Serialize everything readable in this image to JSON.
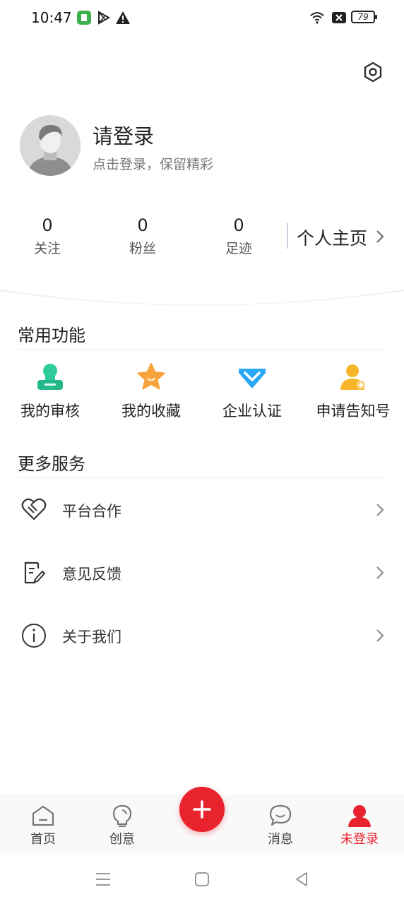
{
  "status_bar": {
    "time": "10:47",
    "battery": "79"
  },
  "header": {
    "login_title": "请登录",
    "login_subtitle": "点击登录，保留精彩",
    "stats": [
      {
        "value": "0",
        "label": "关注"
      },
      {
        "value": "0",
        "label": "粉丝"
      },
      {
        "value": "0",
        "label": "足迹"
      }
    ],
    "profile_link": "个人主页"
  },
  "common_functions": {
    "title": "常用功能",
    "items": [
      {
        "label": "我的审核",
        "icon": "stamp-icon",
        "color": "#2ecb9b"
      },
      {
        "label": "我的收藏",
        "icon": "star-icon",
        "color": "#f7a23b"
      },
      {
        "label": "企业认证",
        "icon": "diamond-v-icon",
        "color": "#29a7f5"
      },
      {
        "label": "申请告知号",
        "icon": "user-add-icon",
        "color": "#f7b52a"
      }
    ]
  },
  "more_services": {
    "title": "更多服务",
    "items": [
      {
        "label": "平台合作",
        "icon": "handshake-icon"
      },
      {
        "label": "意见反馈",
        "icon": "feedback-icon"
      },
      {
        "label": "关于我们",
        "icon": "info-icon"
      }
    ]
  },
  "bottom_nav": {
    "items": [
      {
        "label": "首页",
        "icon": "home-icon",
        "active": false
      },
      {
        "label": "创意",
        "icon": "lightbulb-icon",
        "active": false
      },
      {
        "label": "消息",
        "icon": "chat-icon",
        "active": false
      },
      {
        "label": "未登录",
        "icon": "user-icon",
        "active": true
      }
    ],
    "active_color": "#e8232e"
  }
}
